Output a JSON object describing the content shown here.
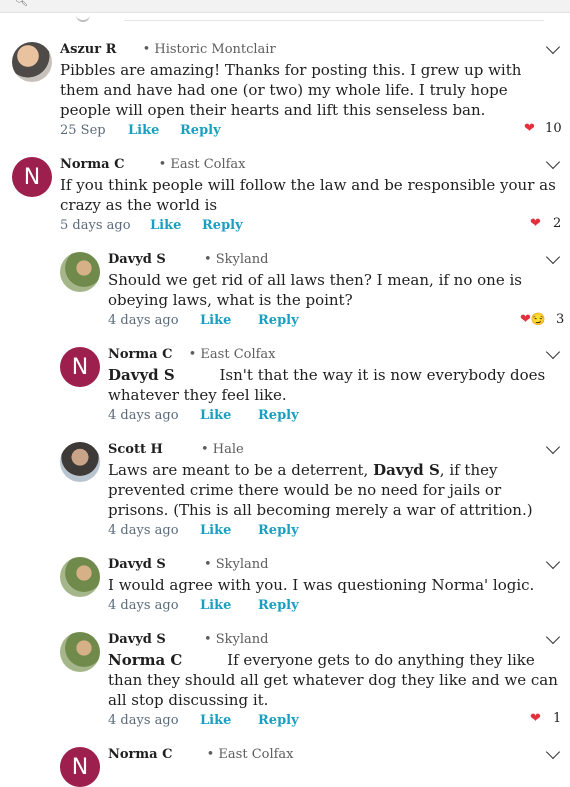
{
  "header_icons": {
    "search": "search-icon"
  },
  "comments": [
    {
      "name": "Aszur R",
      "hood": "Historic Montclair",
      "text": "Pibbles are amazing! Thanks for posting this. I grew up with them and have had one (or two) my whole life. I truly hope people will open their hearts and lift this senseless ban.",
      "time": "25 Sep",
      "like": "Like",
      "reply": "Reply",
      "reactions": "10"
    },
    {
      "name": "Norma C",
      "hood": "East Colfax",
      "avatar_letter": "N",
      "text": "If you think people will follow the law and be responsible your as crazy as the world is",
      "time": "5 days ago",
      "like": "Like",
      "reply": "Reply",
      "reactions": "2"
    },
    {
      "name": "Davyd S",
      "hood": "Skyland",
      "text": "Should we get rid of all laws then?  I mean, if no one is obeying laws, what is the point?",
      "time": "4 days ago",
      "like": "Like",
      "reply": "Reply",
      "reactions": "3"
    },
    {
      "name": "Norma C",
      "hood": "East Colfax",
      "avatar_letter": "N",
      "mention": "Davyd S",
      "text": "Isn't that the way it is now everybody does whatever they feel like.",
      "time": "4 days ago",
      "like": "Like",
      "reply": "Reply"
    },
    {
      "name": "Scott H",
      "hood": "Hale",
      "text_pre": "Laws are meant to be a deterrent, ",
      "mention": "Davyd S",
      "text_post": ", if they prevented crime there would be no need for jails or prisons. (This is all becoming merely a war of attrition.)",
      "time": "4 days ago",
      "like": "Like",
      "reply": "Reply"
    },
    {
      "name": "Davyd S",
      "hood": "Skyland",
      "text": "I would agree with you.  I was questioning Norma' logic.",
      "time": "4 days ago",
      "like": "Like",
      "reply": "Reply"
    },
    {
      "name": "Davyd S",
      "hood": "Skyland",
      "mention": "Norma C",
      "text": "If everyone gets to do anything they like than they should all get whatever dog they like and we can all stop discussing it.",
      "time": "4 days ago",
      "like": "Like",
      "reply": "Reply",
      "reactions": "1"
    },
    {
      "name": "Norma C",
      "hood": "East Colfax",
      "avatar_letter": "N"
    }
  ]
}
